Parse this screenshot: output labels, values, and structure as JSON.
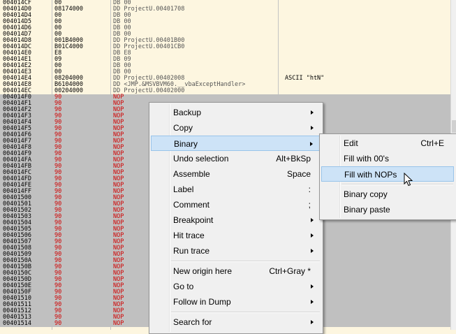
{
  "rows": [
    {
      "addr": "004014CF",
      "hex": "00",
      "asm": "DB 00",
      "cmt": ""
    },
    {
      "addr": "004014D0",
      "hex": "08174000",
      "asm": "DD ProjectU.00401708",
      "cmt": ""
    },
    {
      "addr": "004014D4",
      "hex": "00",
      "asm": "DB 00",
      "cmt": ""
    },
    {
      "addr": "004014D5",
      "hex": "00",
      "asm": "DB 00",
      "cmt": ""
    },
    {
      "addr": "004014D6",
      "hex": "00",
      "asm": "DB 00",
      "cmt": ""
    },
    {
      "addr": "004014D7",
      "hex": "00",
      "asm": "DB 00",
      "cmt": ""
    },
    {
      "addr": "004014D8",
      "hex": "001B4000",
      "asm": "DD ProjectU.00401B00",
      "cmt": ""
    },
    {
      "addr": "004014DC",
      "hex": "B01C4000",
      "asm": "DD ProjectU.00401CB0",
      "cmt": ""
    },
    {
      "addr": "004014E0",
      "hex": "E8",
      "asm": "DB E8",
      "cmt": ""
    },
    {
      "addr": "004014E1",
      "hex": "09",
      "asm": "DB 09",
      "cmt": ""
    },
    {
      "addr": "004014E2",
      "hex": "00",
      "asm": "DB 00",
      "cmt": ""
    },
    {
      "addr": "004014E3",
      "hex": "00",
      "asm": "DB 00",
      "cmt": ""
    },
    {
      "addr": "004014E4",
      "hex": "08204000",
      "asm": "DD ProjectU.00402008",
      "cmt": "ASCII \"htN\""
    },
    {
      "addr": "004014E8",
      "hex": "B6104000",
      "asm": "DD <JMP.&MSVBVM60.__vbaExceptHandler>",
      "cmt": ""
    },
    {
      "addr": "004014EC",
      "hex": "00204000",
      "asm": "DD ProjectU.00402000",
      "cmt": ""
    },
    {
      "addr": "004014F0",
      "hex": "90",
      "asm": "NOP",
      "cmt": ""
    },
    {
      "addr": "004014F1",
      "hex": "90",
      "asm": "NOP",
      "cmt": ""
    },
    {
      "addr": "004014F2",
      "hex": "90",
      "asm": "NOP",
      "cmt": ""
    },
    {
      "addr": "004014F3",
      "hex": "90",
      "asm": "NOP",
      "cmt": ""
    },
    {
      "addr": "004014F4",
      "hex": "90",
      "asm": "NOP",
      "cmt": ""
    },
    {
      "addr": "004014F5",
      "hex": "90",
      "asm": "NOP",
      "cmt": ""
    },
    {
      "addr": "004014F6",
      "hex": "90",
      "asm": "NOP",
      "cmt": ""
    },
    {
      "addr": "004014F7",
      "hex": "90",
      "asm": "NOP",
      "cmt": ""
    },
    {
      "addr": "004014F8",
      "hex": "90",
      "asm": "NOP",
      "cmt": ""
    },
    {
      "addr": "004014F9",
      "hex": "90",
      "asm": "NOP",
      "cmt": ""
    },
    {
      "addr": "004014FA",
      "hex": "90",
      "asm": "NOP",
      "cmt": ""
    },
    {
      "addr": "004014FB",
      "hex": "90",
      "asm": "NOP",
      "cmt": ""
    },
    {
      "addr": "004014FC",
      "hex": "90",
      "asm": "NOP",
      "cmt": ""
    },
    {
      "addr": "004014FD",
      "hex": "90",
      "asm": "NOP",
      "cmt": ""
    },
    {
      "addr": "004014FE",
      "hex": "90",
      "asm": "NOP",
      "cmt": ""
    },
    {
      "addr": "004014FF",
      "hex": "90",
      "asm": "NOP",
      "cmt": ""
    },
    {
      "addr": "00401500",
      "hex": "90",
      "asm": "NOP",
      "cmt": ""
    },
    {
      "addr": "00401501",
      "hex": "90",
      "asm": "NOP",
      "cmt": ""
    },
    {
      "addr": "00401502",
      "hex": "90",
      "asm": "NOP",
      "cmt": ""
    },
    {
      "addr": "00401503",
      "hex": "90",
      "asm": "NOP",
      "cmt": ""
    },
    {
      "addr": "00401504",
      "hex": "90",
      "asm": "NOP",
      "cmt": ""
    },
    {
      "addr": "00401505",
      "hex": "90",
      "asm": "NOP",
      "cmt": ""
    },
    {
      "addr": "00401506",
      "hex": "90",
      "asm": "NOP",
      "cmt": ""
    },
    {
      "addr": "00401507",
      "hex": "90",
      "asm": "NOP",
      "cmt": ""
    },
    {
      "addr": "00401508",
      "hex": "90",
      "asm": "NOP",
      "cmt": ""
    },
    {
      "addr": "00401509",
      "hex": "90",
      "asm": "NOP",
      "cmt": ""
    },
    {
      "addr": "0040150A",
      "hex": "90",
      "asm": "NOP",
      "cmt": ""
    },
    {
      "addr": "0040150B",
      "hex": "90",
      "asm": "NOP",
      "cmt": ""
    },
    {
      "addr": "0040150C",
      "hex": "90",
      "asm": "NOP",
      "cmt": ""
    },
    {
      "addr": "0040150D",
      "hex": "90",
      "asm": "NOP",
      "cmt": ""
    },
    {
      "addr": "0040150E",
      "hex": "90",
      "asm": "NOP",
      "cmt": ""
    },
    {
      "addr": "0040150F",
      "hex": "90",
      "asm": "NOP",
      "cmt": ""
    },
    {
      "addr": "00401510",
      "hex": "90",
      "asm": "NOP",
      "cmt": ""
    },
    {
      "addr": "00401511",
      "hex": "90",
      "asm": "NOP",
      "cmt": ""
    },
    {
      "addr": "00401512",
      "hex": "90",
      "asm": "NOP",
      "cmt": ""
    },
    {
      "addr": "00401513",
      "hex": "90",
      "asm": "NOP",
      "cmt": ""
    },
    {
      "addr": "00401514",
      "hex": "90",
      "asm": "NOP",
      "cmt": ""
    }
  ],
  "selection_start_index": 15,
  "context_menu": {
    "items": [
      {
        "label": "Backup",
        "shortcut": "",
        "submenu": true,
        "name": "menu-backup"
      },
      {
        "label": "Copy",
        "shortcut": "",
        "submenu": true,
        "name": "menu-copy"
      },
      {
        "label": "Binary",
        "shortcut": "",
        "submenu": true,
        "name": "menu-binary",
        "highlighted": true
      },
      {
        "label": "Undo selection",
        "shortcut": "Alt+BkSp",
        "submenu": false,
        "name": "menu-undo-selection"
      },
      {
        "label": "Assemble",
        "shortcut": "Space",
        "submenu": false,
        "name": "menu-assemble"
      },
      {
        "label": "Label",
        "shortcut": ":",
        "submenu": false,
        "name": "menu-label"
      },
      {
        "label": "Comment",
        "shortcut": ";",
        "submenu": false,
        "name": "menu-comment"
      },
      {
        "label": "Breakpoint",
        "shortcut": "",
        "submenu": true,
        "name": "menu-breakpoint"
      },
      {
        "label": "Hit trace",
        "shortcut": "",
        "submenu": true,
        "name": "menu-hit-trace"
      },
      {
        "label": "Run trace",
        "shortcut": "",
        "submenu": true,
        "name": "menu-run-trace"
      },
      {
        "separator": true
      },
      {
        "label": "New origin here",
        "shortcut": "Ctrl+Gray *",
        "submenu": false,
        "name": "menu-new-origin"
      },
      {
        "label": "Go to",
        "shortcut": "",
        "submenu": true,
        "name": "menu-go-to"
      },
      {
        "label": "Follow in Dump",
        "shortcut": "",
        "submenu": true,
        "name": "menu-follow-in-dump"
      },
      {
        "separator": true
      },
      {
        "label": "Search for",
        "shortcut": "",
        "submenu": true,
        "name": "menu-search-for"
      }
    ]
  },
  "binary_submenu": {
    "items": [
      {
        "label": "Edit",
        "shortcut": "Ctrl+E",
        "name": "submenu-edit"
      },
      {
        "label": "Fill with 00's",
        "shortcut": "",
        "name": "submenu-fill-00"
      },
      {
        "label": "Fill with NOPs",
        "shortcut": "",
        "name": "submenu-fill-nops",
        "highlighted": true
      },
      {
        "separator": true
      },
      {
        "label": "Binary copy",
        "shortcut": "",
        "name": "submenu-binary-copy"
      },
      {
        "label": "Binary paste",
        "shortcut": "",
        "name": "submenu-binary-paste"
      }
    ]
  }
}
